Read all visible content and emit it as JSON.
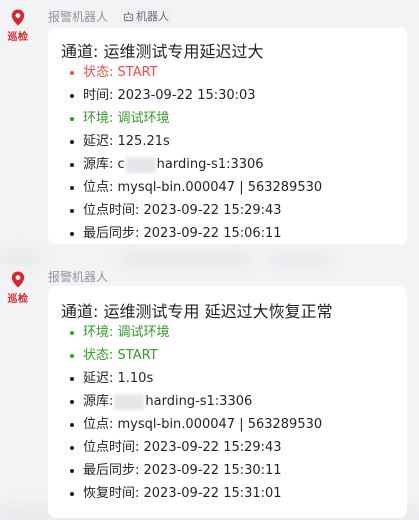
{
  "avatar": {
    "label": "巡检"
  },
  "messages": [
    {
      "sender": "报警机器人",
      "bot_tag": "机器人",
      "title": "通道: 运维测试专用延迟过大",
      "fields": [
        {
          "text": "状态: START",
          "tone": "red"
        },
        {
          "text": "时间: 2023-09-22 15:30:03",
          "tone": "normal"
        },
        {
          "text": "环境: 调试环境",
          "tone": "green"
        },
        {
          "text": "延迟: 125.21s",
          "tone": "normal"
        },
        {
          "prefix": "源库: c",
          "suffix": "harding-s1:3306",
          "tone": "normal"
        },
        {
          "text": "位点: mysql-bin.000047 | 563289530",
          "tone": "normal"
        },
        {
          "text": "位点时间: 2023-09-22 15:29:43",
          "tone": "normal"
        },
        {
          "text": "最后同步: 2023-09-22 15:06:11",
          "tone": "normal"
        }
      ]
    },
    {
      "sender": "报警机器人",
      "title": "通道: 运维测试专用 延迟过大恢复正常",
      "fields": [
        {
          "text": "环境: 调试环境",
          "tone": "green"
        },
        {
          "text": "状态: START",
          "tone": "green"
        },
        {
          "text": "延迟: 1.10s",
          "tone": "normal"
        },
        {
          "prefix": "源库: ",
          "suffix": "harding-s1:3306",
          "tone": "normal"
        },
        {
          "text": "位点: mysql-bin.000047 | 563289530",
          "tone": "normal"
        },
        {
          "text": "位点时间: 2023-09-22 15:29:43",
          "tone": "normal"
        },
        {
          "text": "最后同步: 2023-09-22 15:30:11",
          "tone": "normal"
        },
        {
          "text": "恢复时间: 2023-09-22 15:31:01",
          "tone": "normal"
        }
      ]
    }
  ],
  "colors": {
    "red": "#f54a45",
    "green": "#2ea121",
    "text": "#1f2329",
    "avatar": "#d9262c"
  }
}
